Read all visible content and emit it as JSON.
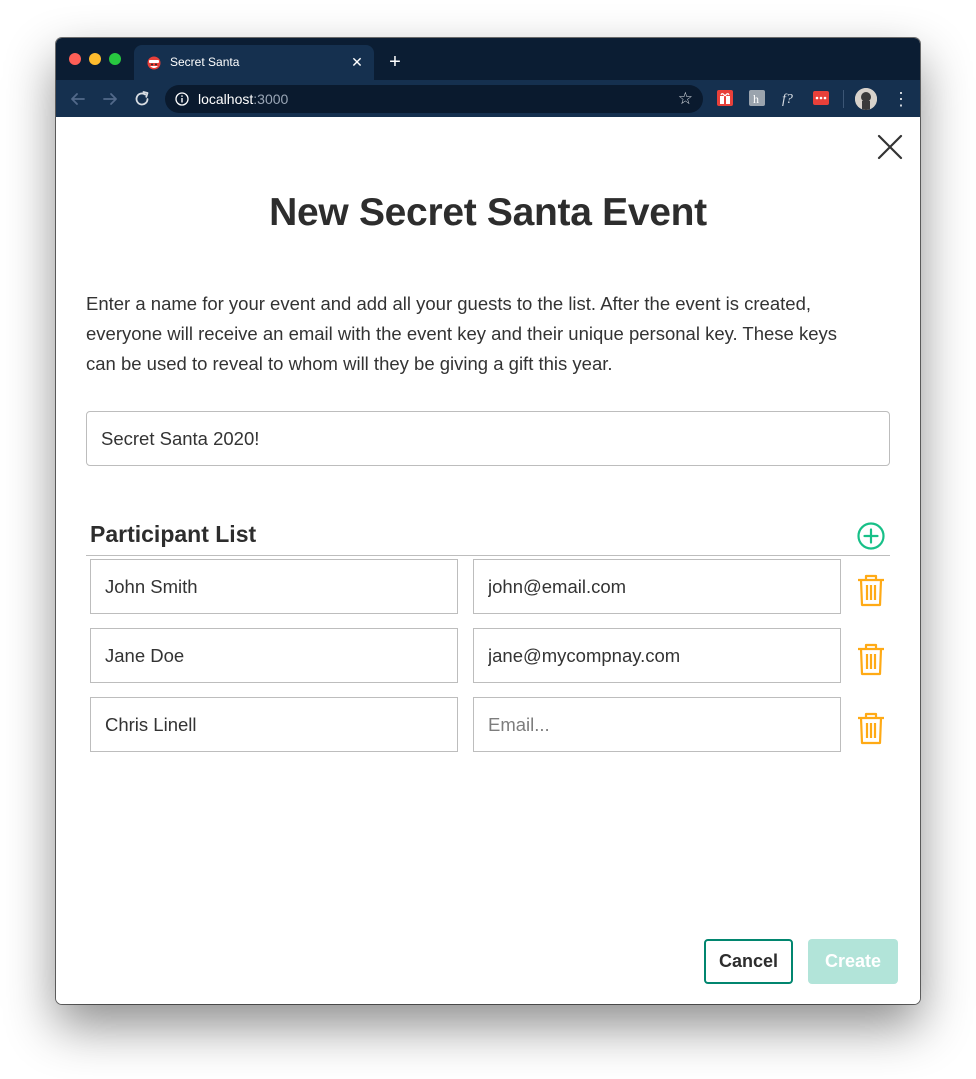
{
  "browser": {
    "tab_title": "Secret Santa",
    "url_host": "localhost",
    "url_port": ":3000",
    "icons": [
      "back-arrow-icon",
      "forward-arrow-icon",
      "reload-icon",
      "info-icon",
      "star-icon",
      "extension-icons",
      "profile-avatar",
      "menu-dots-icon"
    ]
  },
  "modal": {
    "title": "New Secret Santa Event",
    "description_lines": [
      "Enter a name for your event and add all your guests to the list. After the event is created,",
      "everyone will receive an email with the event key and their unique personal key. These keys",
      "can be used to reveal to whom will they be giving a gift this year."
    ],
    "event_name_value": "Secret Santa 2020!",
    "participant_list_label": "Participant List",
    "participants": [
      {
        "name": "John Smith",
        "email": "john@email.com",
        "email_placeholder": "Email..."
      },
      {
        "name": "Jane Doe",
        "email": "jane@mycompnay.com",
        "email_placeholder": "Email..."
      },
      {
        "name": "Chris Linell",
        "email": "",
        "email_placeholder": "Email..."
      }
    ],
    "cancel_label": "Cancel",
    "create_label": "Create"
  },
  "colors": {
    "accent_green": "#01866f",
    "add_icon_green": "#17c088",
    "trash_orange": "#ffaa15",
    "create_disabled": "#b2e4d9",
    "browser_frame": "#0b1d33",
    "browser_toolbar": "#15304f"
  }
}
